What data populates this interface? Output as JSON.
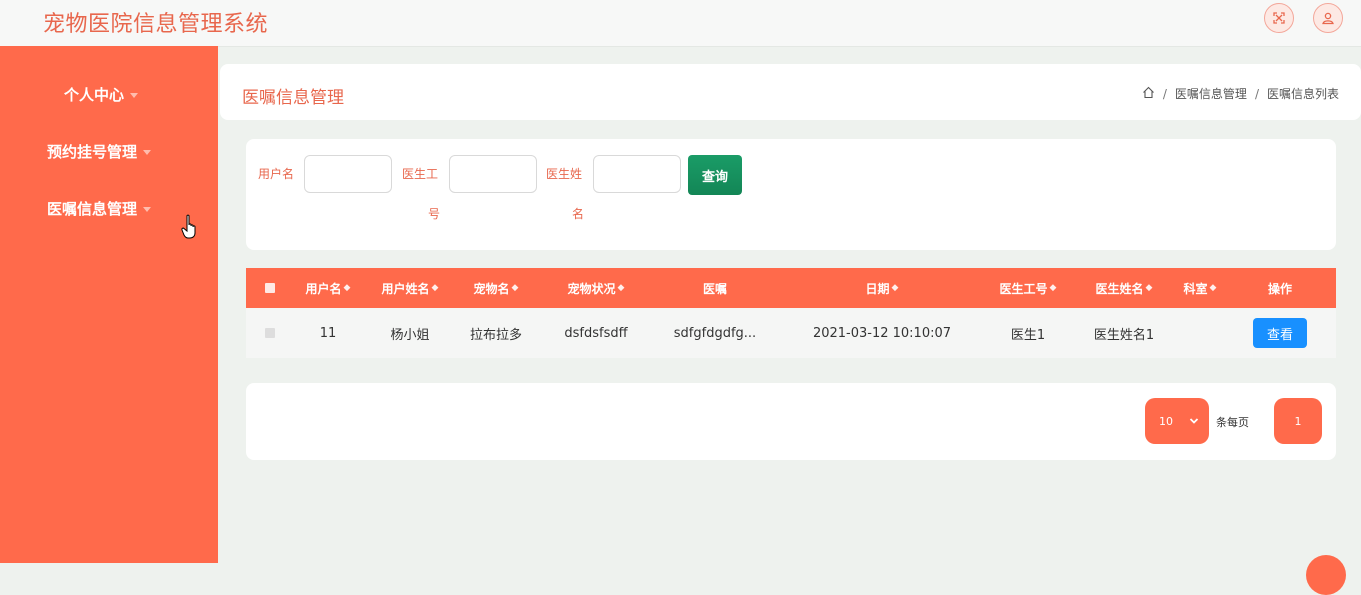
{
  "app": {
    "title": "宠物医院信息管理系统"
  },
  "topbar": {
    "icons": [
      "fullscreen-icon",
      "user-icon"
    ]
  },
  "sidebar": {
    "items": [
      {
        "label": "个人中心"
      },
      {
        "label": "预约挂号管理"
      },
      {
        "label": "医嘱信息管理"
      }
    ]
  },
  "page": {
    "heading": "医嘱信息管理",
    "breadcrumb": [
      "医嘱信息管理",
      "医嘱信息列表"
    ]
  },
  "search": {
    "username_label": "用户名",
    "doctor_id_label_1": "医生工",
    "doctor_id_label_2": "号",
    "doctor_name_label_1": "医生姓",
    "doctor_name_label_2": "名",
    "username_value": "",
    "doctor_id_value": "",
    "doctor_name_value": "",
    "query_label": "查询"
  },
  "table": {
    "columns": [
      "用户名",
      "用户姓名",
      "宠物名",
      "宠物状况",
      "医嘱",
      "日期",
      "医生工号",
      "医生姓名",
      "科室",
      "操作"
    ],
    "rows": [
      {
        "username": "11",
        "user_name": "杨小姐",
        "pet_name": "拉布拉多",
        "pet_condition": "dsfdsfsdff",
        "advice": "sdfgfdgdfg...",
        "date": "2021-03-12 10:10:07",
        "doctor_id": "医生1",
        "doctor_name": "医生姓名1",
        "department": "",
        "action_label": "查看"
      }
    ]
  },
  "pagination": {
    "page_size": "10",
    "per_page_label": "条每页",
    "current_page": "1"
  },
  "colors": {
    "accent": "#ff6a4b",
    "title": "#e8674d",
    "query": "#1a9c67",
    "view": "#1890ff"
  }
}
